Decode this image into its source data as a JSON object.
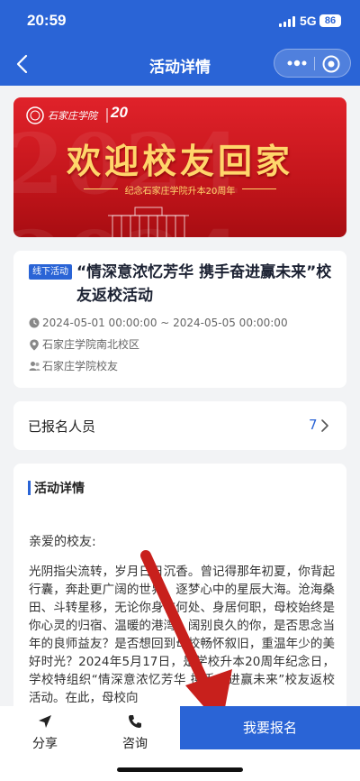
{
  "status_bar": {
    "time": "20:59",
    "network": "5G",
    "battery": "86"
  },
  "nav": {
    "title": "活动详情"
  },
  "banner": {
    "org_name": "石家庄学院",
    "anniversary": "20",
    "headline": "欢迎校友回家",
    "subtitle": "纪念石家庄学院升本20周年",
    "watermark": "2024 2024"
  },
  "activity": {
    "tag": "线下活动",
    "title": "“情深意浓忆芳华 携手奋进赢未来”校友返校活动",
    "time_range": "2024-05-01 00:00:00 ~ 2024-05-05 00:00:00",
    "location": "石家庄学院南北校区",
    "audience": "石家庄学院校友"
  },
  "registered": {
    "label": "已报名人员",
    "count": "7"
  },
  "details": {
    "section_title": "活动详情",
    "greeting": "亲爱的校友:",
    "body": "光阴指尖流转，岁月日日沉香。曾记得那年初夏，你背起行囊，奔赴更广阔的世界，逐梦心中的星辰大海。沧海桑田、斗转星移，无论你身在何处、身居何职，母校始终是你心灵的归宿、温暖的港湾。阔别良久的你，是否思念当年的良师益友？是否想回到母校畅怀叙旧，重温年少的美好时光？2024年5月17日，是学校升本20周年纪念日，学校特组织“情深意浓忆芳华 携手奋进赢未来”校友返校活动。在此，母校向"
  },
  "bottom_bar": {
    "share": "分享",
    "consult": "咨询",
    "signup": "我要报名"
  },
  "colors": {
    "primary": "#2a64d6",
    "banner_red": "#d41a20",
    "banner_gold": "#ffd66b",
    "arrow_red": "#c8201c"
  }
}
